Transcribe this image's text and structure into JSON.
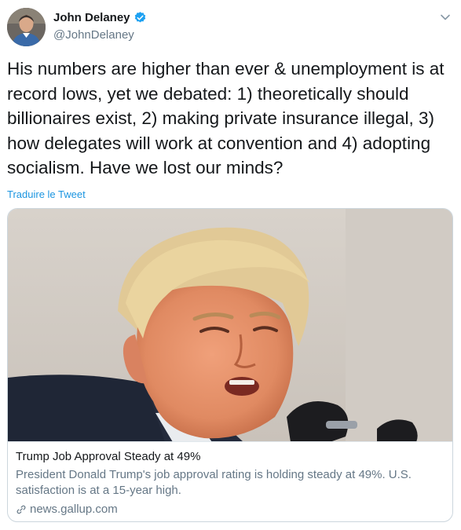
{
  "author": {
    "name": "John Delaney",
    "handle": "@JohnDelaney",
    "verified": true
  },
  "tweet": {
    "text": "His numbers are higher than ever & unemployment is at record lows, yet we debated: 1) theoretically should billionaires exist, 2) making private insurance illegal, 3) how delegates will work at convention and 4) adopting socialism. Have we lost our minds?",
    "translate_label": "Traduire le Tweet"
  },
  "card": {
    "title": "Trump Job Approval Steady at 49%",
    "description": "President Donald Trump's job approval rating is holding steady at 49%. U.S. satisfaction is at a 15-year high.",
    "domain": "news.gallup.com"
  },
  "icons": {
    "verified": "verified-badge-icon",
    "caret": "chevron-down-icon",
    "link": "link-icon"
  },
  "colors": {
    "accent": "#1da1f2",
    "link": "#1b95e0",
    "secondary_text": "#657786",
    "border": "#ccd6dd"
  }
}
